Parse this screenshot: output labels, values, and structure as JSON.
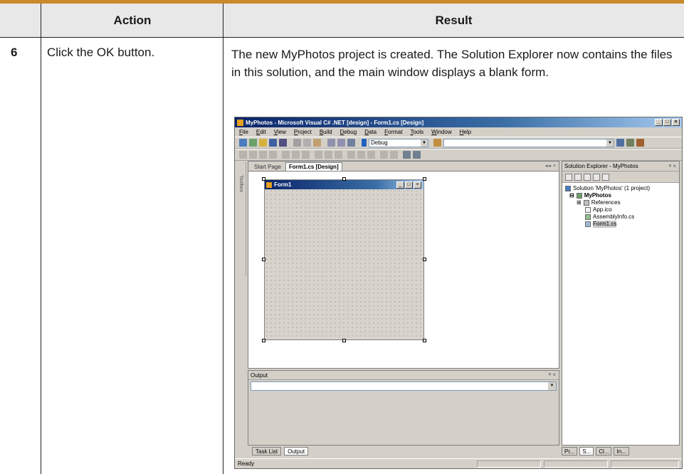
{
  "table": {
    "headers": {
      "action": "Action",
      "result": "Result"
    },
    "rows": [
      {
        "step": "6",
        "action": "Click the OK button.",
        "result": "The new MyPhotos project is created. The Solution Explorer now contains the files in this solution, and the main window displays a blank form."
      }
    ]
  },
  "screenshot": {
    "title": "MyPhotos - Microsoft Visual C# .NET [design] - Form1.cs [Design]",
    "menu": [
      "File",
      "Edit",
      "View",
      "Project",
      "Build",
      "Debug",
      "Data",
      "Format",
      "Tools",
      "Window",
      "Help"
    ],
    "config_combo": "Debug",
    "doc_tabs": [
      "Start Page",
      "Form1.cs [Design]"
    ],
    "toolbox_label": "Toolbox",
    "form_title": "Form1",
    "output_title": "Output",
    "bottom_tabs": [
      "Task List",
      "Output"
    ],
    "solution_title": "Solution Explorer - MyPhotos",
    "tree": [
      "Solution 'MyPhotos' (1 project)",
      "MyPhotos",
      "References",
      "App.ico",
      "AssemblyInfo.cs",
      "Form1.cs"
    ],
    "solution_tabs": [
      "Pr...",
      "S...",
      "Cl...",
      "In..."
    ],
    "status": "Ready",
    "colors": {
      "accent_bar": "#c88a2a",
      "titlebar": "#0a246a",
      "chrome": "#d4d0c8"
    }
  }
}
